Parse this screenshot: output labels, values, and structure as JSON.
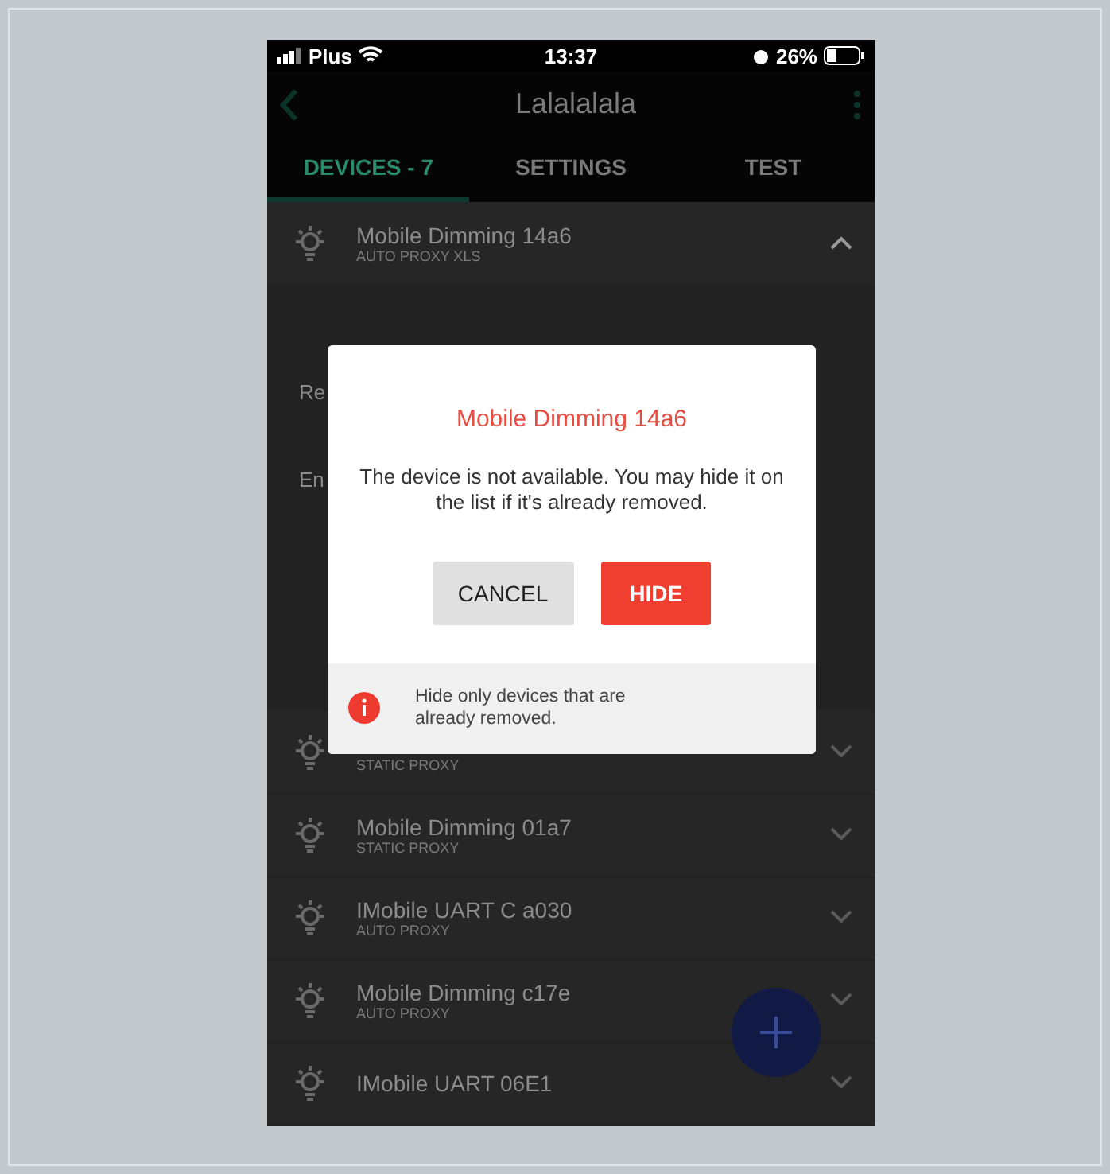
{
  "status_bar": {
    "carrier": "Plus",
    "time": "13:37",
    "battery": "26%"
  },
  "app_bar": {
    "title": "Lalalalala"
  },
  "tabs": [
    {
      "label": "DEVICES - 7",
      "selected": true
    },
    {
      "label": "SETTINGS",
      "selected": false
    },
    {
      "label": "TEST",
      "selected": false
    }
  ],
  "devices": [
    {
      "name": "Mobile Dimming 14a6",
      "subtitle": "AUTO PROXY XLS",
      "expanded": true,
      "details": [
        "Re",
        "En"
      ]
    },
    {
      "subtitle": "STATIC PROXY",
      "expanded": false
    },
    {
      "name": "Mobile Dimming 01a7",
      "subtitle": "STATIC PROXY",
      "expanded": false
    },
    {
      "name": "IMobile UART C a030",
      "subtitle": "AUTO PROXY",
      "expanded": false
    },
    {
      "name": "Mobile Dimming c17e",
      "subtitle": "AUTO PROXY",
      "expanded": false
    },
    {
      "name": "IMobile UART 06E1",
      "expanded": false
    }
  ],
  "dialog": {
    "title": "Mobile Dimming 14a6",
    "message": "The device is not available. You may hide it on the list if it's already removed.",
    "buttons": [
      {
        "label": "CANCEL",
        "kind": "secondary"
      },
      {
        "label": "HIDE",
        "kind": "primary"
      }
    ],
    "note": "Hide only devices that are already removed."
  }
}
